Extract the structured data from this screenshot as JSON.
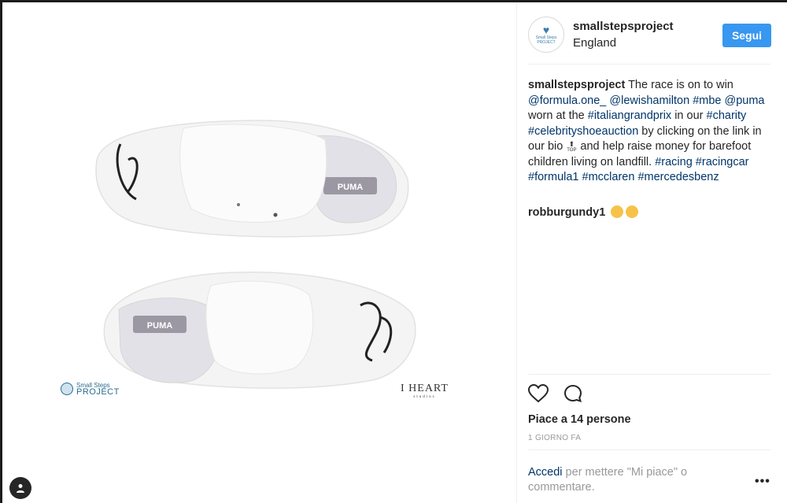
{
  "post": {
    "username": "smallstepsproject",
    "location": "England",
    "follow_label": "Segui",
    "avatar_text": "Small Steps PROJECT"
  },
  "caption": {
    "username": "smallstepsproject",
    "segments": [
      {
        "t": " The race is on to win ",
        "link": false
      },
      {
        "t": "@formula.one_",
        "link": true
      },
      {
        "t": " ",
        "link": false
      },
      {
        "t": "@lewishamilton",
        "link": true
      },
      {
        "t": " ",
        "link": false
      },
      {
        "t": "#mbe",
        "link": true
      },
      {
        "t": " ",
        "link": false
      },
      {
        "t": "@puma",
        "link": true
      },
      {
        "t": " worn at the ",
        "link": false
      },
      {
        "t": "#italiangrandprix",
        "link": true
      },
      {
        "t": " in our ",
        "link": false
      },
      {
        "t": "#charity",
        "link": true
      },
      {
        "t": " ",
        "link": false
      },
      {
        "t": "#celebrityshoeauction",
        "link": true
      },
      {
        "t": " by clicking on the link in our bio ",
        "link": false
      },
      {
        "t": "__TOP__",
        "link": false
      },
      {
        "t": " and help raise money for barefoot children living on landfill. ",
        "link": false
      },
      {
        "t": "#racing",
        "link": true
      },
      {
        "t": " ",
        "link": false
      },
      {
        "t": "#racingcar",
        "link": true
      },
      {
        "t": " ",
        "link": false
      },
      {
        "t": "#formula1",
        "link": true
      },
      {
        "t": " ",
        "link": false
      },
      {
        "t": "#mcclaren",
        "link": true
      },
      {
        "t": " ",
        "link": false
      },
      {
        "t": "#mercedesbenz",
        "link": true
      }
    ],
    "top_emoji_label": "TOP"
  },
  "comment": {
    "username": "robburgundy1",
    "emoji": [
      "thumbs-up-emoji",
      "clapping-hands-emoji"
    ]
  },
  "actions": {
    "like_icon": "heart-icon",
    "comment_icon": "comment-icon"
  },
  "likes_text": "Piace a 14 persone",
  "date_text": "1 GIORNO FA",
  "login": {
    "link_text": "Accedi",
    "rest_text": " per mettere \"Mi piace\" o commentare."
  },
  "more_label": "•••",
  "photo": {
    "watermark_left_small": "Small Steps",
    "watermark_left_big": "PROJECT",
    "watermark_right_big": "I HEART",
    "watermark_right_small": "studios",
    "insole_brand": "PUMA"
  },
  "colors": {
    "accent": "#3897f0",
    "link": "#003569",
    "text": "#262626",
    "muted": "#999999"
  }
}
